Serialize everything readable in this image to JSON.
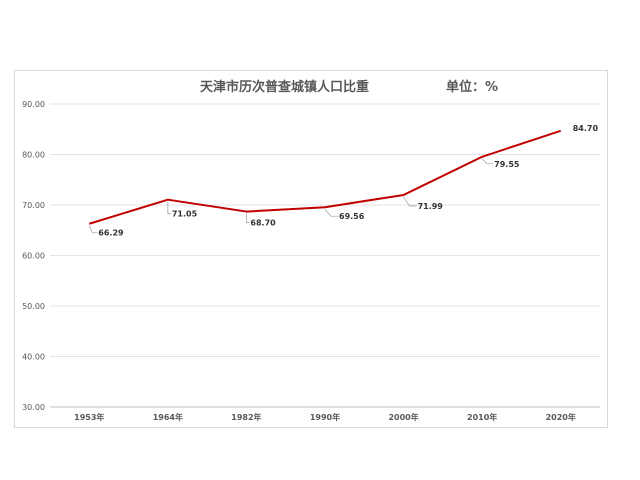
{
  "chart_data": {
    "type": "line",
    "title": "天津市历次普查城镇人口比重",
    "unit_label": "单位：%",
    "categories": [
      "1953年",
      "1964年",
      "1982年",
      "1990年",
      "2000年",
      "2010年",
      "2020年"
    ],
    "series": [
      {
        "values": [
          66.29,
          71.05,
          68.7,
          69.56,
          71.99,
          79.55,
          84.7
        ],
        "labels": [
          "66.29",
          "71.05",
          "68.70",
          "69.56",
          "71.99",
          "79.55",
          "84.70"
        ],
        "color": "#c00000"
      }
    ],
    "y_ticks": [
      "30.00",
      "40.00",
      "50.00",
      "60.00",
      "70.00",
      "80.00",
      "90.00"
    ],
    "ylim": [
      30,
      90
    ],
    "grid": true,
    "legend": "none"
  }
}
